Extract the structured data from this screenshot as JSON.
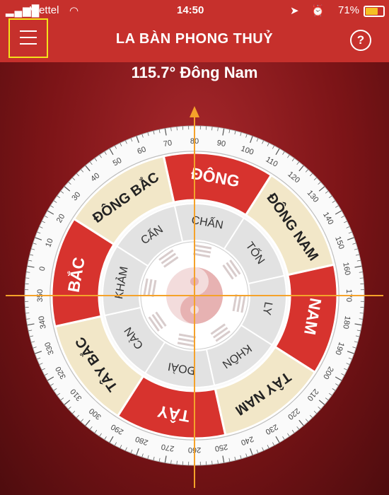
{
  "status_bar": {
    "carrier": "Viettel",
    "time": "14:50",
    "battery": "71%"
  },
  "nav": {
    "title": "LA BÀN PHONG THUỶ",
    "help_label": "?"
  },
  "heading": "115.7° Đông Nam",
  "compass": {
    "heading_degrees": 115.7,
    "direction_labels": [
      "ĐÔNG",
      "ĐÔNG NAM",
      "NAM",
      "TÂY NAM",
      "TÂY",
      "TÂY BẮC",
      "BẮC",
      "ĐÔNG BẮC"
    ],
    "trigram_labels": [
      "CHẤN",
      "TỐN",
      "LY",
      "KHÔN",
      "ĐOÀI",
      "CÀN",
      "KHẢM",
      "CẤN"
    ],
    "degree_labels": [
      "0",
      "10",
      "20",
      "30",
      "40",
      "50",
      "60",
      "70",
      "80",
      "90",
      "100",
      "110",
      "120",
      "130",
      "140",
      "150",
      "160",
      "170",
      "180",
      "190",
      "200",
      "210",
      "220",
      "230",
      "240",
      "250",
      "260",
      "270",
      "280",
      "290",
      "300",
      "310",
      "320",
      "330",
      "340",
      "350"
    ],
    "colors": {
      "red": "#d7332e",
      "cream": "#f2e7c8",
      "accent_line": "#f5a22a",
      "light_gray": "#e2e2e2"
    }
  }
}
